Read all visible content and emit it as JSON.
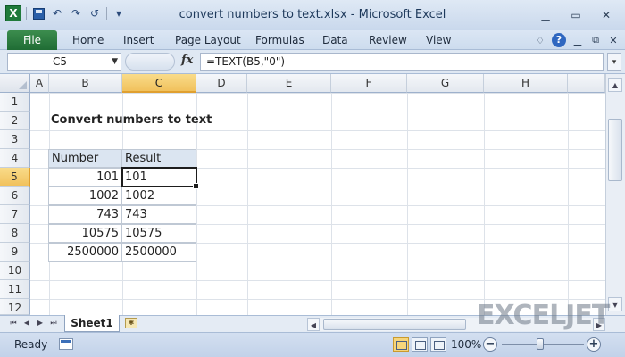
{
  "window": {
    "title": "convert numbers to text.xlsx - Microsoft Excel"
  },
  "qat": {
    "logo": "X",
    "undo": "↶",
    "redo": "↷",
    "more": "▾"
  },
  "window_buttons": {
    "minimize": "▭",
    "restore": "⧉",
    "close": "✕"
  },
  "ribbon": {
    "file_label": "File",
    "tabs": [
      "Home",
      "Insert",
      "Page Layout",
      "Formulas",
      "Data",
      "Review",
      "View"
    ],
    "help": "?"
  },
  "formula_bar": {
    "name_box": "C5",
    "fx": "fx",
    "formula": "=TEXT(B5,\"0\")"
  },
  "columns": [
    "A",
    "B",
    "C",
    "D",
    "E",
    "F",
    "G",
    "H"
  ],
  "rows": [
    "1",
    "2",
    "3",
    "4",
    "5",
    "6",
    "7",
    "8",
    "9",
    "10",
    "11",
    "12"
  ],
  "sheet": {
    "title": "Convert numbers to text",
    "table": {
      "headers": [
        "Number",
        "Result"
      ],
      "rows": [
        [
          "101",
          "101"
        ],
        [
          "1002",
          "1002"
        ],
        [
          "743",
          "743"
        ],
        [
          "10575",
          "10575"
        ],
        [
          "2500000",
          "2500000"
        ]
      ]
    },
    "active_cell": "C5"
  },
  "sheet_tabs": {
    "active": "Sheet1"
  },
  "status": {
    "text": "Ready",
    "zoom": "100%",
    "zoom_minus": "−",
    "zoom_plus": "+"
  },
  "watermark": {
    "text": "EXCELJET"
  },
  "colors": {
    "active_header": "#f1c15c",
    "file_tab": "#1f6c34",
    "table_header": "#dbe5f1"
  }
}
